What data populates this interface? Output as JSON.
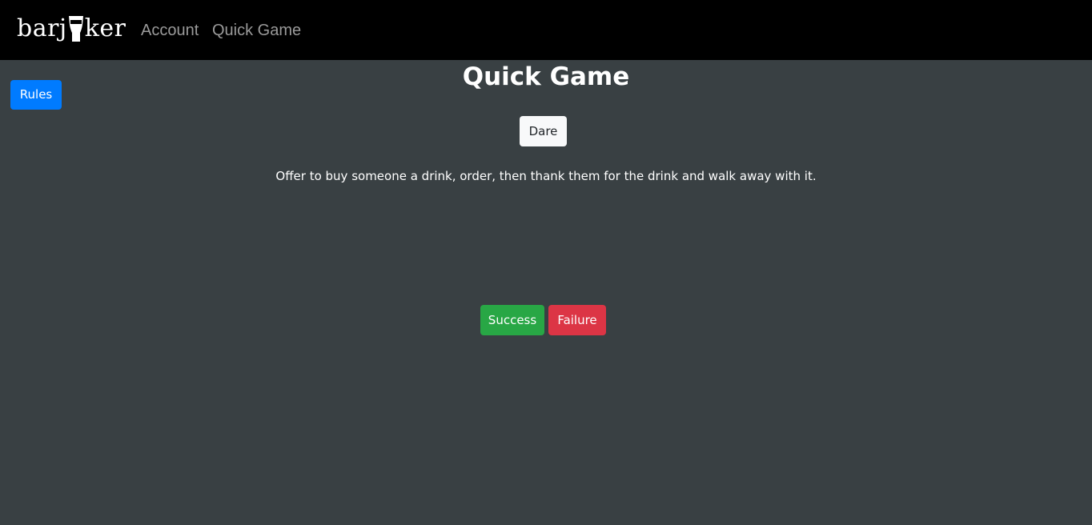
{
  "navbar": {
    "brand": {
      "text_before": "barj",
      "text_after": "ker",
      "icon": "pint-glass-icon"
    },
    "links": [
      {
        "label": "Account"
      },
      {
        "label": "Quick Game"
      }
    ]
  },
  "main": {
    "title": "Quick Game",
    "rules_label": "Rules",
    "card_type_label": "Dare",
    "card_text": "Offer to buy someone a drink, order, then thank them for the drink and walk away with it.",
    "success_label": "Success",
    "failure_label": "Failure"
  },
  "colors": {
    "navbar_bg": "#000000",
    "page_bg": "#394043",
    "rules_button": "#007bff",
    "dare_button": "#f8f9fa",
    "success_button": "#28a745",
    "failure_button": "#dc3545",
    "nav_link": "#9a9a9a"
  }
}
